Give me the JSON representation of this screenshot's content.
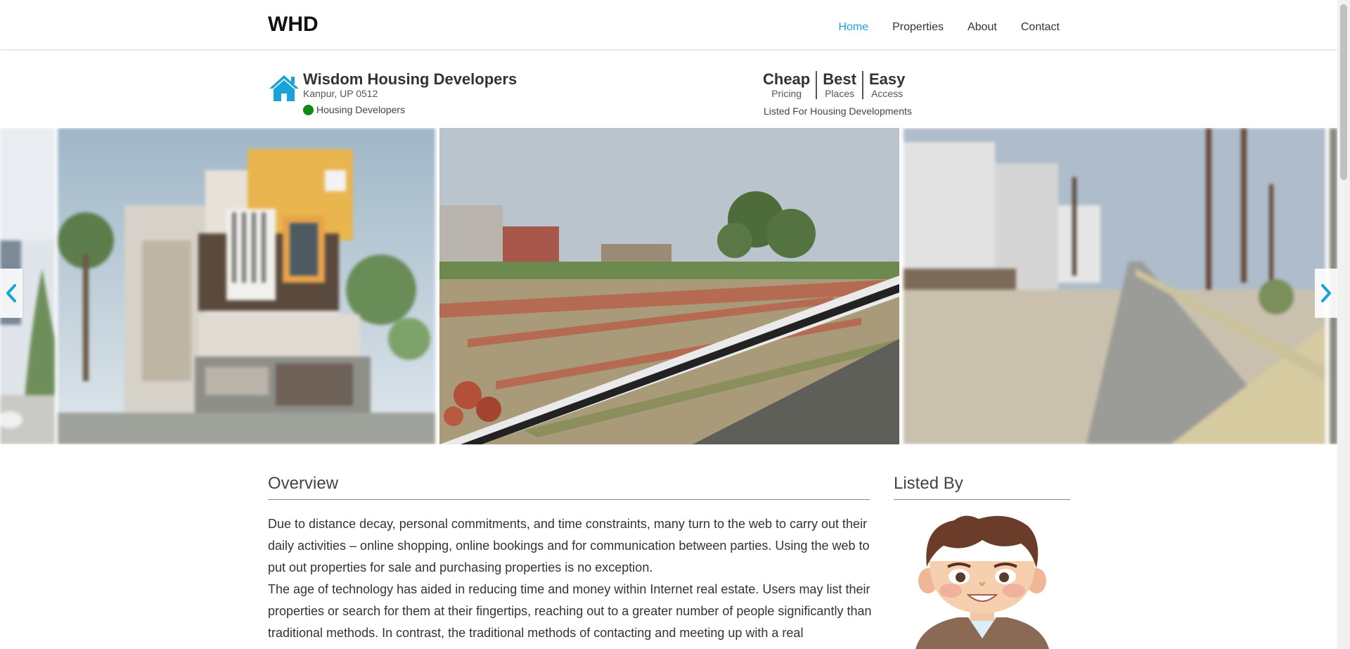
{
  "navbar": {
    "brand": "WHD",
    "links": [
      "Home",
      "Properties",
      "About",
      "Contact"
    ],
    "active": "Home"
  },
  "listing": {
    "icon": "home-icon",
    "name": "Wisdom Housing Developers",
    "address": "Kanpur, UP 0512",
    "category": "Housing Developers",
    "status_color": "#138a13"
  },
  "features": [
    {
      "title": "Cheap",
      "sub": "Pricing"
    },
    {
      "title": "Best",
      "sub": "Places"
    },
    {
      "title": "Easy",
      "sub": "Access"
    }
  ],
  "listed_for": "Listed For Housing Developments",
  "carousel": {
    "prev_icon": "chevron-left-icon",
    "next_icon": "chevron-right-icon"
  },
  "overview": {
    "title": "Overview",
    "paragraphs": [
      "Due to distance decay, personal commitments, and time constraints, many turn to the web to carry out their daily activities – online shopping, online bookings and for communication between parties. Using the web to put out properties for sale and purchasing properties is no exception.",
      "The age of technology has aided in reducing time and money within Internet real estate. Users may list their properties or search for them at their fingertips, reaching out to a greater number of people significantly than traditional methods. In contrast, the traditional methods of contacting and meeting up with a real"
    ]
  },
  "listed_by": {
    "title": "Listed By"
  },
  "colors": {
    "accent": "#1aa3d9",
    "status": "#138a13"
  }
}
